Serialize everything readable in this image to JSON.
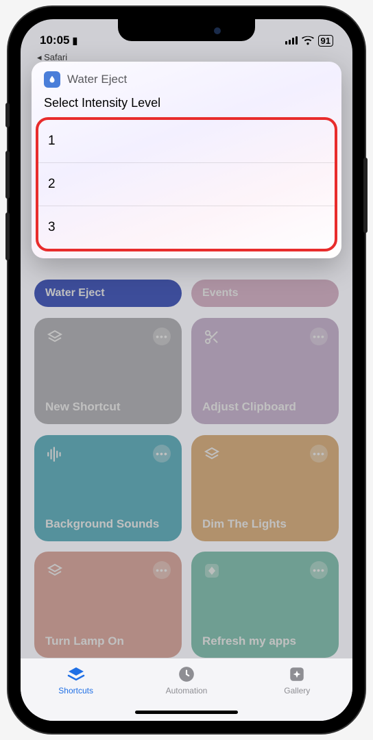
{
  "statusbar": {
    "time": "10:05",
    "battery": "91"
  },
  "breadcrumb": {
    "back": "◂ Safari"
  },
  "modal": {
    "title": "Water Eject",
    "subtitle": "Select Intensity Level",
    "options": [
      "1",
      "2",
      "3"
    ]
  },
  "tiles": {
    "t0": "Water Eject",
    "t1": "Events",
    "t2": "New Shortcut",
    "t3": "Adjust Clipboard",
    "t4": "Background Sounds",
    "t5": "Dim The Lights",
    "t6": "Turn Lamp On",
    "t7": "Refresh my apps"
  },
  "tabbar": {
    "shortcuts": "Shortcuts",
    "automation": "Automation",
    "gallery": "Gallery"
  },
  "icons": {
    "more": "•••"
  }
}
